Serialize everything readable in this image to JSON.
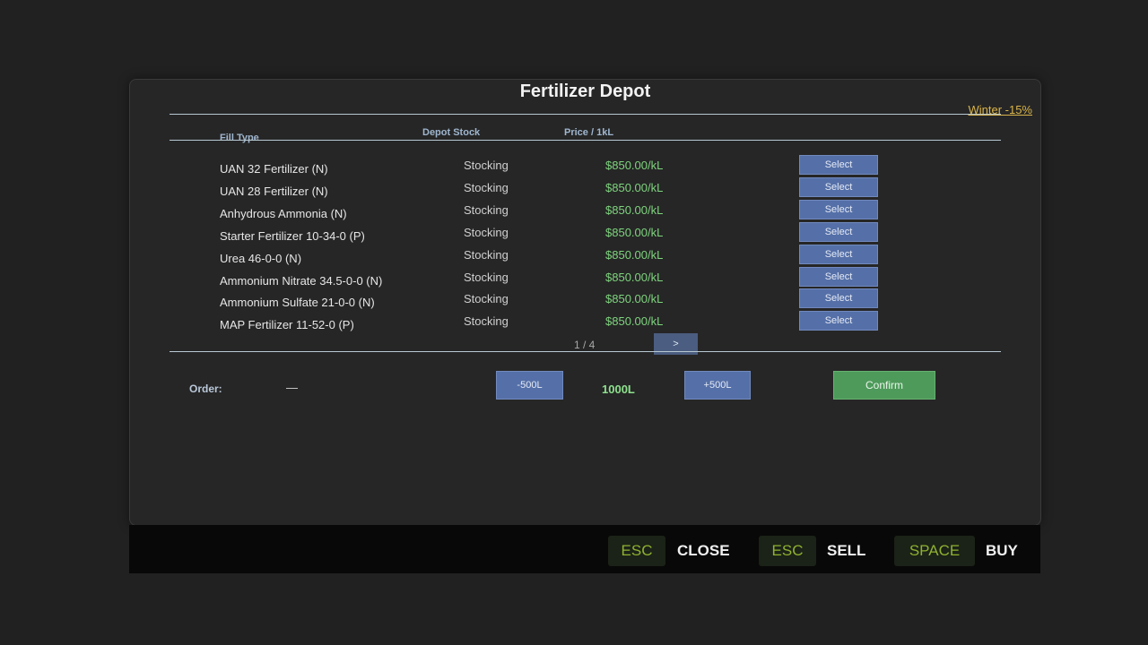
{
  "header": {
    "title": "Fertilizer Depot",
    "season_modifier": "Winter -15%"
  },
  "colors": {
    "season": "#d9b44a",
    "price": "#7fd37f",
    "select_button": "#5570a8",
    "confirm_button": "#4e9a5a",
    "key_text": "#8fb130"
  },
  "table": {
    "columns": {
      "fill_type": "Fill Type",
      "depot_stock": "Depot Stock",
      "price": "Price / 1kL"
    },
    "rows": [
      {
        "name": "UAN 32 Fertilizer (N)",
        "stock": "Stocking",
        "price": "$850.00/kL",
        "action": "Select"
      },
      {
        "name": "UAN 28 Fertilizer (N)",
        "stock": "Stocking",
        "price": "$850.00/kL",
        "action": "Select"
      },
      {
        "name": "Anhydrous Ammonia (N)",
        "stock": "Stocking",
        "price": "$850.00/kL",
        "action": "Select"
      },
      {
        "name": "Starter Fertilizer 10-34-0 (P)",
        "stock": "Stocking",
        "price": "$850.00/kL",
        "action": "Select"
      },
      {
        "name": "Urea 46-0-0 (N)",
        "stock": "Stocking",
        "price": "$850.00/kL",
        "action": "Select"
      },
      {
        "name": "Ammonium Nitrate 34.5-0-0 (N)",
        "stock": "Stocking",
        "price": "$850.00/kL",
        "action": "Select"
      },
      {
        "name": "Ammonium Sulfate 21-0-0 (N)",
        "stock": "Stocking",
        "price": "$850.00/kL",
        "action": "Select"
      },
      {
        "name": "MAP Fertilizer 11-52-0 (P)",
        "stock": "Stocking",
        "price": "$850.00/kL",
        "action": "Select"
      }
    ]
  },
  "pagination": {
    "label": "1 / 4",
    "next_label": ">"
  },
  "order": {
    "label": "Order:",
    "value": "—",
    "decrease_label": "-500L",
    "quantity": "1000L",
    "increase_label": "+500L",
    "confirm_label": "Confirm"
  },
  "footer": {
    "close_key": "ESC",
    "close_label": "CLOSE",
    "sell_key": "ESC",
    "sell_label": "SELL",
    "buy_key": "SPACE",
    "buy_label": "BUY"
  }
}
